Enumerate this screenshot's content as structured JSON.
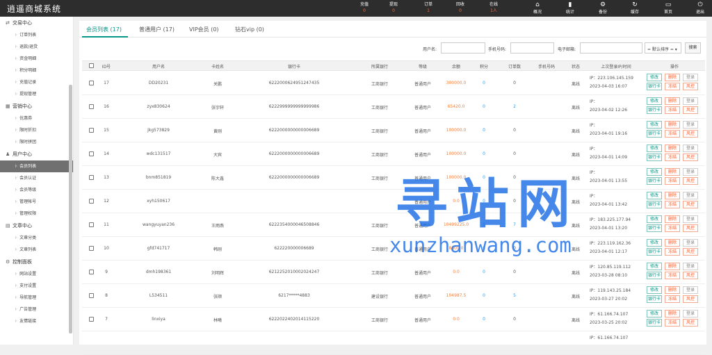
{
  "app": {
    "title": "逍遥商城系统"
  },
  "topbar": {
    "stats": [
      {
        "label": "充值",
        "value": "0"
      },
      {
        "label": "提现",
        "value": "0"
      },
      {
        "label": "订单",
        "value": "1"
      },
      {
        "label": "回收",
        "value": "0"
      },
      {
        "label": "在线",
        "value": "1人"
      }
    ],
    "tools": [
      {
        "label": "概况",
        "icon": "home-icon",
        "glyph": "⌂"
      },
      {
        "label": "统计",
        "icon": "bar-chart-icon",
        "glyph": "▮"
      },
      {
        "label": "备份",
        "icon": "gear-icon",
        "glyph": "⚙"
      },
      {
        "label": "缓存",
        "icon": "refresh-icon",
        "glyph": "↻"
      },
      {
        "label": "首页",
        "icon": "monitor-icon",
        "glyph": "▭"
      },
      {
        "label": "退出",
        "icon": "logout-icon",
        "glyph": "⏻"
      }
    ]
  },
  "sidebar": {
    "sections": [
      {
        "label": "交易中心",
        "icon": "exchange-icon",
        "glyph": "⇄",
        "items": [
          "订单列表",
          "退款/退货",
          "资金明细",
          "积分明细",
          "充值记录",
          "提现管理"
        ]
      },
      {
        "label": "营销中心",
        "icon": "marketing-icon",
        "glyph": "▦",
        "items": [
          "优惠券",
          "限时折扣",
          "限时拼团"
        ]
      },
      {
        "label": "用户中心",
        "icon": "user-icon",
        "glyph": "♟",
        "items": [
          "会员列表",
          "会员认证",
          "会员等级",
          "管理帐号",
          "管理权限"
        ]
      },
      {
        "label": "文章中心",
        "icon": "article-icon",
        "glyph": "▤",
        "items": [
          "文章分类",
          "文章列表"
        ]
      },
      {
        "label": "控制面板",
        "icon": "control-icon",
        "glyph": "⚙",
        "items": [
          "网站设置",
          "支付设置",
          "导航管理",
          "广告管理",
          "友情链接"
        ]
      }
    ],
    "active_item": "会员列表"
  },
  "tabs": [
    {
      "label": "会员列表 (17)"
    },
    {
      "label": "普通用户 (17)"
    },
    {
      "label": "VIP会员 (0)"
    },
    {
      "label": "钻石vip (0)"
    }
  ],
  "search": {
    "username_label": "用户名:",
    "phone_label": "手机号码:",
    "email_label": "电子邮箱:",
    "username_value": "",
    "phone_value": "",
    "email_value": "",
    "sort_value": "= 默认排序 =",
    "search_button": "搜索"
  },
  "table": {
    "headers": [
      "ID号",
      "用户名",
      "卡姓名",
      "银行卡",
      "所属银行",
      "等级",
      "余额",
      "积分",
      "订单数",
      "手机号码",
      "状态",
      "上次登录IP/时间",
      "操作"
    ],
    "actions": {
      "edit": "修改",
      "delete": "删除",
      "login": "登录",
      "bank": "银行卡",
      "freeze": "冻结",
      "risk": "风控"
    },
    "ip_prefix": "IP：",
    "rows": [
      {
        "id": "17",
        "username": "DD20231",
        "card_name": "关鹏",
        "card": "6222000624951247435",
        "bank": "工商银行",
        "level": "普通用户",
        "balance": "300000.0",
        "points": "0",
        "orders": "0",
        "phone": "",
        "status": "离线",
        "ip": "223.106.145.159",
        "time": "2023-04-03 16:07"
      },
      {
        "id": "16",
        "username": "zyx830624",
        "card_name": "张宇轩",
        "card": "6222999999999999986",
        "bank": "工商银行",
        "level": "普通用户",
        "balance": "65420.0",
        "points": "0",
        "orders": "2",
        "phone": "",
        "status": "离线",
        "ip": "",
        "time": "2023-04-02 12:26"
      },
      {
        "id": "15",
        "username": "jkg573829",
        "card_name": "黄刚",
        "card": "6222000000000006689",
        "bank": "工商银行",
        "level": "普通用户",
        "balance": "100000.0",
        "points": "0",
        "orders": "0",
        "phone": "",
        "status": "离线",
        "ip": "",
        "time": "2023-04-01 19:16"
      },
      {
        "id": "14",
        "username": "wdc131517",
        "card_name": "大宾",
        "card": "6222000000000006689",
        "bank": "工商银行",
        "level": "普通用户",
        "balance": "100000.0",
        "points": "0",
        "orders": "0",
        "phone": "",
        "status": "离线",
        "ip": "",
        "time": "2023-04-01 14:09"
      },
      {
        "id": "13",
        "username": "bnm851819",
        "card_name": "陈大鑫",
        "card": "6222000000000006689",
        "bank": "工商银行",
        "level": "普通用户",
        "balance": "100000.0",
        "points": "0",
        "orders": "0",
        "phone": "",
        "status": "离线",
        "ip": "",
        "time": "2023-04-01 13:55"
      },
      {
        "id": "12",
        "username": "xyh150617",
        "card_name": "",
        "card": "",
        "bank": "",
        "level": "普通用户",
        "balance": "0.0",
        "points": "0",
        "orders": "0",
        "phone": "",
        "status": "离线",
        "ip": "",
        "time": "2023-04-01 13:42"
      },
      {
        "id": "11",
        "username": "wangyuyan236",
        "card_name": "王雨燕",
        "card": "6222354000046508846",
        "bank": "工商银行",
        "level": "普通用户",
        "balance": "10499225.0",
        "points": "0",
        "orders": "7",
        "phone": "",
        "status": "离线",
        "ip": "183.225.177.94",
        "time": "2023-04-01 13:20"
      },
      {
        "id": "10",
        "username": "gfd741717",
        "card_name": "韩刚",
        "card": "622220000006689",
        "bank": "工商银行",
        "level": "普通用户",
        "balance": "8500.0",
        "points": "0",
        "orders": "0",
        "phone": "",
        "status": "离线",
        "ip": "223.119.162.36",
        "time": "2023-04-01 12:17"
      },
      {
        "id": "9",
        "username": "dmh198361",
        "card_name": "刘明辉",
        "card": "6212252010002024247",
        "bank": "工商银行",
        "level": "普通用户",
        "balance": "0.0",
        "points": "0",
        "orders": "0",
        "phone": "",
        "status": "离线",
        "ip": "120.85.119.112",
        "time": "2023-03-28 08:10"
      },
      {
        "id": "8",
        "username": "L534511",
        "card_name": "张顺",
        "card": "6217*****4883",
        "bank": "建设银行",
        "level": "普通用户",
        "balance": "104987.5",
        "points": "0",
        "orders": "5",
        "phone": "",
        "status": "离线",
        "ip": "119.143.25.184",
        "time": "2023-03-27 20:02"
      },
      {
        "id": "7",
        "username": "linxiya",
        "card_name": "林曦",
        "card": "6222022402014115220",
        "bank": "工商银行",
        "level": "普通用户",
        "balance": "0.0",
        "points": "0",
        "orders": "0",
        "phone": "",
        "status": "离线",
        "ip": "61.166.74.107",
        "time": "2023-03-25 20:02"
      },
      {
        "id": "",
        "username": "",
        "card_name": "",
        "card": "",
        "bank": "",
        "level": "",
        "balance": "",
        "points": "",
        "orders": "",
        "phone": "",
        "status": "",
        "ip": "61.166.74.107",
        "time": ""
      }
    ]
  },
  "watermark": {
    "cn": "寻站网",
    "en": "xunzhanwang.com"
  }
}
